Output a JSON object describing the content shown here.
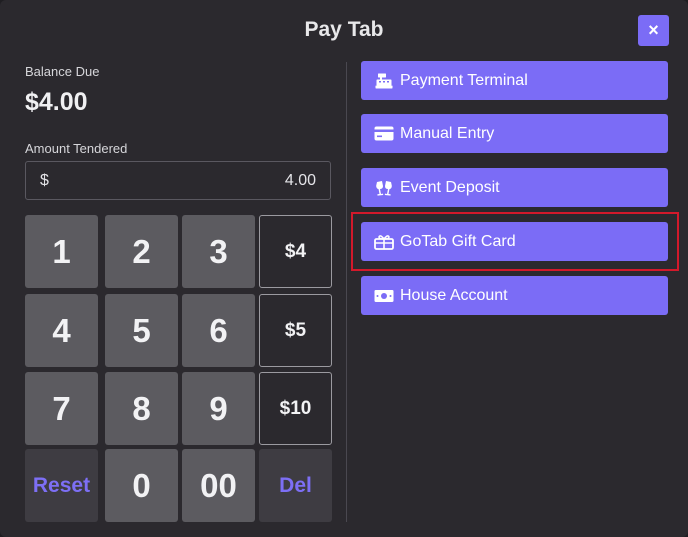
{
  "modal": {
    "title": "Pay Tab",
    "close_label": "×"
  },
  "balance": {
    "label": "Balance Due",
    "value": "$4.00"
  },
  "tendered": {
    "label": "Amount Tendered",
    "currency": "$",
    "value": "4.00"
  },
  "keypad": {
    "k1": "1",
    "k2": "2",
    "k3": "3",
    "k4": "4",
    "k5": "5",
    "k6": "6",
    "k7": "7",
    "k8": "8",
    "k9": "9",
    "k0": "0",
    "k00": "00",
    "reset": "Reset",
    "del": "Del",
    "q4": "$4",
    "q5": "$5",
    "q10": "$10"
  },
  "payment_methods": [
    {
      "label": "Payment Terminal",
      "icon": "cash-register-icon"
    },
    {
      "label": "Manual Entry",
      "icon": "credit-card-icon"
    },
    {
      "label": "Event Deposit",
      "icon": "champagne-glasses-icon"
    },
    {
      "label": "GoTab Gift Card",
      "icon": "gift-card-icon"
    },
    {
      "label": "House Account",
      "icon": "money-bill-icon"
    }
  ],
  "colors": {
    "accent": "#7b6cf6",
    "highlight": "#d3192b",
    "background": "#2b292e"
  }
}
